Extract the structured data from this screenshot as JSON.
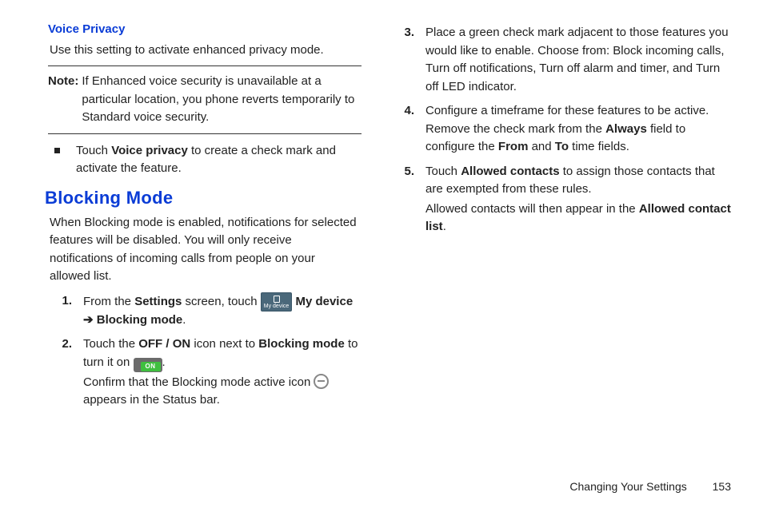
{
  "col1": {
    "voice_privacy_heading": "Voice Privacy",
    "voice_privacy_para": "Use this setting to activate enhanced privacy mode.",
    "note_label": "Note:",
    "note_body": "If Enhanced voice security is unavailable at a particular location, you phone reverts temporarily to Standard voice security.",
    "bullet_pre": "Touch ",
    "bullet_bold": "Voice privacy",
    "bullet_post": " to create a check mark and activate the feature.",
    "blocking_heading": "Blocking Mode",
    "blocking_intro": "When Blocking mode is enabled, notifications for selected features will be disabled. You will only receive notifications of incoming calls from people on your allowed list.",
    "steps": {
      "s1": {
        "num": "1.",
        "t1": "From the ",
        "b1": "Settings",
        "t2": " screen, touch ",
        "icon_label": "My device",
        "b2": "My device",
        "arrow": " ➔ ",
        "b3": "Blocking mode",
        "t3": "."
      },
      "s2": {
        "num": "2.",
        "t1": "Touch the ",
        "b1": "OFF / ON",
        "t2": " icon next to ",
        "b2": "Blocking mode",
        "t3": " to turn it on ",
        "on_label": "ON",
        "t4": ".",
        "cont1": "Confirm that the Blocking mode active icon ",
        "cont2": " appears in the Status bar."
      }
    }
  },
  "col2": {
    "steps": {
      "s3": {
        "num": "3.",
        "text": "Place a green check mark adjacent to those features you would like to enable. Choose from: Block incoming calls, Turn off notifications, Turn off alarm and timer, and Turn off LED indicator."
      },
      "s4": {
        "num": "4.",
        "t1": "Configure a timeframe for these features to be active. Remove the check mark from the ",
        "b1": "Always",
        "t2": " field to configure the ",
        "b2": "From",
        "t3": " and ",
        "b3": "To",
        "t4": " time fields."
      },
      "s5": {
        "num": "5.",
        "t1": "Touch ",
        "b1": "Allowed contacts",
        "t2": " to assign those contacts that are exempted from these rules.",
        "cont1": "Allowed contacts will then appear in the ",
        "bcont": "Allowed contact list",
        "cont2": "."
      }
    }
  },
  "footer": {
    "section": "Changing Your Settings",
    "page": "153"
  }
}
